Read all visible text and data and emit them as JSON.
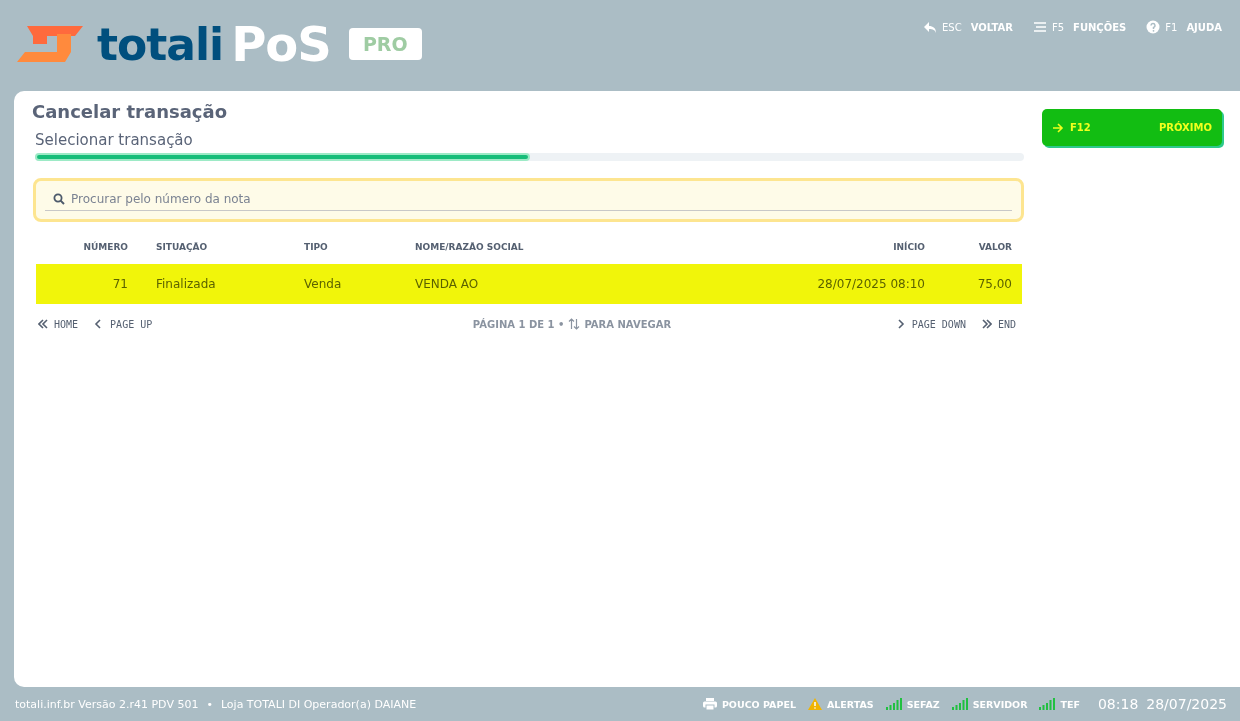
{
  "header": {
    "logo": {
      "brand": "totali",
      "product": "PoS",
      "badge": "PRO"
    },
    "shortcuts": [
      {
        "kind": "back",
        "key": "ESC",
        "label": "VOLTAR"
      },
      {
        "kind": "menu",
        "key": "F5",
        "label": "FUNÇÕES"
      },
      {
        "kind": "help",
        "key": "F1",
        "label": "AJUDA"
      }
    ]
  },
  "page": {
    "title": "Cancelar transação",
    "step": "Selecionar transação",
    "progress": {
      "level": 0.5
    },
    "search": {
      "placeholder": "Procurar pelo número da nota"
    },
    "table": {
      "columns": [
        "NÚMERO",
        "SITUAÇÃO",
        "TIPO",
        "NOME/RAZÃO SOCIAL",
        "INÍCIO",
        "VALOR"
      ],
      "rows": [
        {
          "selected": true,
          "cells": [
            "71",
            "Finalizada",
            "Venda",
            "VENDA AO",
            "28/07/2025 08:10",
            "75,00"
          ]
        }
      ]
    },
    "pager": {
      "first": "HOME",
      "prev": "PAGE UP",
      "info": "PÁGINA 1 DE 1 •",
      "hint": "PARA NAVEGAR",
      "next": "PAGE DOWN",
      "last": "END"
    }
  },
  "next_button": {
    "key": "F12",
    "label": "PRÓXIMO"
  },
  "status_bar": {
    "info": "totali.inf.br Versão 2.r41 PDV 501",
    "separator": "•",
    "store": "Loja TOTALI DI Operador(a) DAIANE",
    "indicators": [
      {
        "kind": "printer",
        "label": "POUCO PAPEL"
      },
      {
        "kind": "alert",
        "label": "ALERTAS"
      },
      {
        "kind": "signal",
        "label": "SEFAZ"
      },
      {
        "kind": "signal",
        "label": "SERVIDOR"
      },
      {
        "kind": "signal",
        "label": "TEF"
      }
    ],
    "time": "08:18",
    "date": "28/07/2025"
  }
}
